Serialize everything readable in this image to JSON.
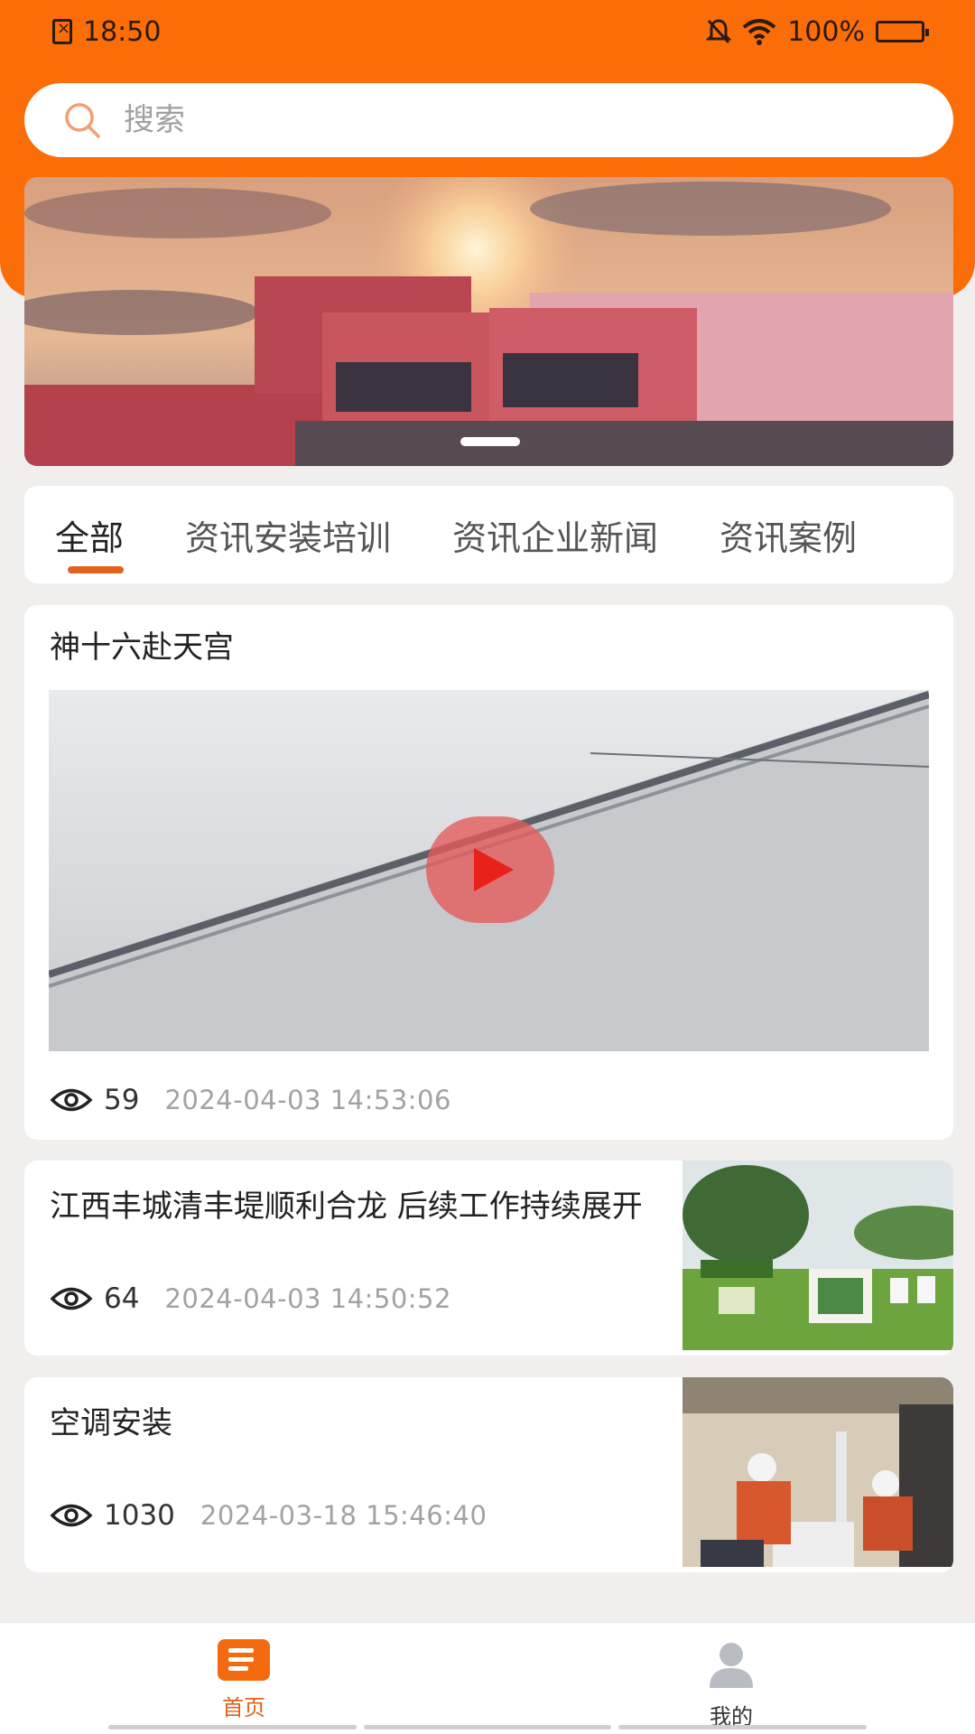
{
  "status_bar": {
    "time": "18:50",
    "battery": "100%"
  },
  "search": {
    "placeholder": "搜索"
  },
  "banner": {
    "active_index": 0
  },
  "tabs": [
    {
      "label": "全部",
      "active": true
    },
    {
      "label": "资讯安装培训",
      "active": false
    },
    {
      "label": "资讯企业新闻",
      "active": false
    },
    {
      "label": "资讯案例",
      "active": false
    }
  ],
  "articles": [
    {
      "title": "神十六赴天宫",
      "views": "59",
      "date": "2024-04-03 14:53:06",
      "media": "video"
    },
    {
      "title": "江西丰城清丰堤顺利合龙 后续工作持续展开",
      "views": "64",
      "date": "2024-04-03 14:50:52",
      "media": "image"
    },
    {
      "title": "空调安装",
      "views": "1030",
      "date": "2024-03-18 15:46:40",
      "media": "image"
    }
  ],
  "bottom_nav": [
    {
      "label": "首页",
      "icon": "news-icon",
      "active": true
    },
    {
      "label": "我的",
      "icon": "user-icon",
      "active": false
    }
  ],
  "colors": {
    "brand": "#fb6d06",
    "accent": "#e2621a",
    "background": "#f1efee"
  }
}
